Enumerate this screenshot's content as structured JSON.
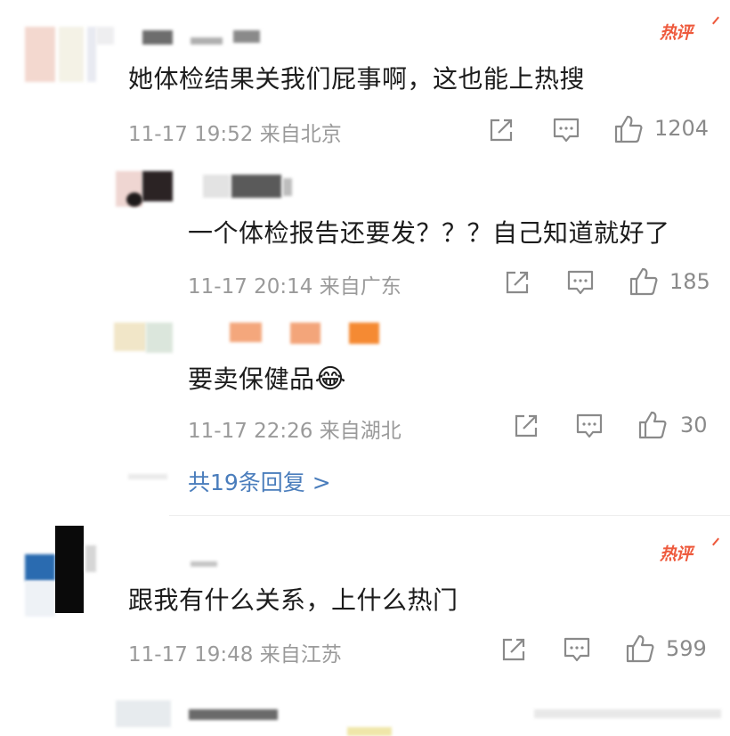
{
  "comments": [
    {
      "badge": "热评",
      "text": "她体检结果关我们屁事啊，这也能上热搜",
      "time": "11-17 19:52",
      "location": "来自北京",
      "likes": "1204"
    },
    {
      "text": "跟我有什么关系，上什么热门",
      "badge": "热评",
      "time": "11-17 19:48",
      "location": "来自江苏",
      "likes": "599"
    }
  ],
  "replies": [
    {
      "text": "一个体检报告还要发？？？自己知道就好了",
      "time": "11-17 20:14",
      "location": "来自广东",
      "likes": "185"
    },
    {
      "text": "要卖保健品",
      "emoji": "😂",
      "time": "11-17 22:26",
      "location": "来自湖北",
      "likes": "30"
    }
  ],
  "more_replies": "共19条回复 >",
  "colors": {
    "hot_badge": "#ee5a3d",
    "link": "#4a7dbc",
    "meta": "#9a9a9a"
  }
}
